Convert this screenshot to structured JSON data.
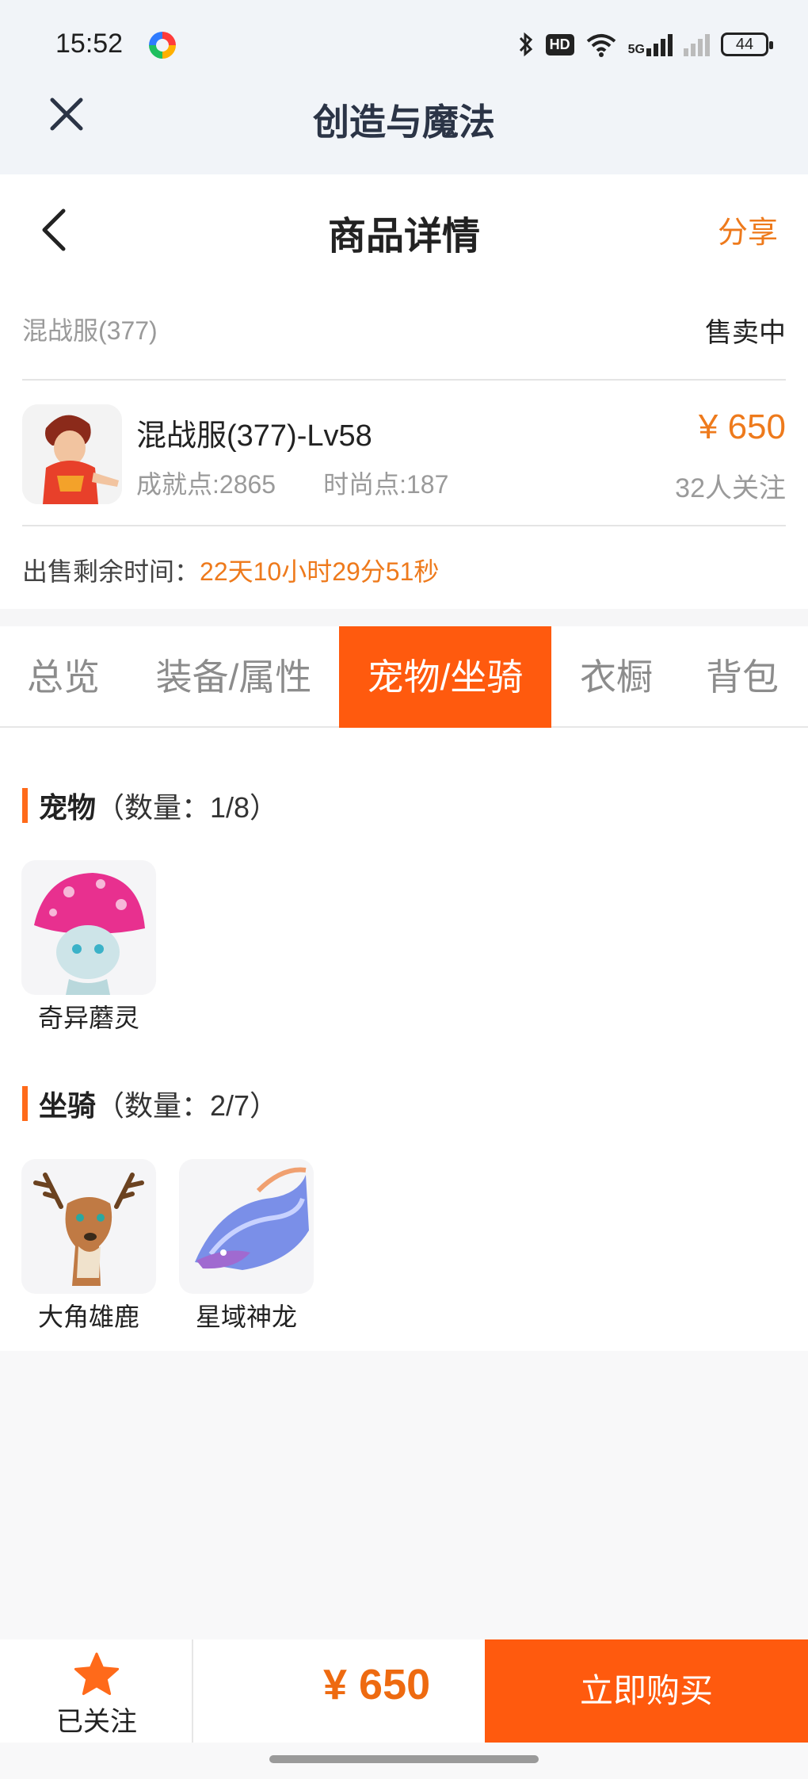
{
  "status_bar": {
    "time": "15:52",
    "hd": "HD",
    "network": "5G",
    "battery": "44"
  },
  "app_header": {
    "title": "创造与魔法"
  },
  "nav": {
    "title": "商品详情",
    "share_label": "分享"
  },
  "listing": {
    "server_name": "混战服(377)",
    "sale_status": "售卖中",
    "item_name": "混战服(377)-Lv58",
    "achievement_points": "成就点:2865",
    "fashion_points": "时尚点:187",
    "price": "¥ 650",
    "followers": "32人关注",
    "remaining_label": "出售剩余时间：",
    "remaining_value": "22天10小时29分51秒"
  },
  "tabs": [
    {
      "label": "总览",
      "active": false
    },
    {
      "label": "装备/属性",
      "active": false
    },
    {
      "label": "宠物/坐骑",
      "active": true
    },
    {
      "label": "衣橱",
      "active": false
    },
    {
      "label": "背包",
      "active": false
    }
  ],
  "pets": {
    "title": "宠物",
    "count": "（数量：1/8）",
    "items": [
      {
        "name": "奇异蘑灵"
      }
    ]
  },
  "mounts": {
    "title": "坐骑",
    "count": "（数量：2/7）",
    "items": [
      {
        "name": "大角雄鹿"
      },
      {
        "name": "星域神龙"
      }
    ]
  },
  "bottom_bar": {
    "follow_label": "已关注",
    "price": "¥ 650",
    "buy_label": "立即购买"
  },
  "colors": {
    "accent": "#ff5a0e",
    "price_orange": "#ee7a1c"
  },
  "icons": [
    "close-icon",
    "back-arrow-icon",
    "star-icon",
    "bluetooth-icon",
    "wifi-icon",
    "signal-icon",
    "battery-icon"
  ]
}
